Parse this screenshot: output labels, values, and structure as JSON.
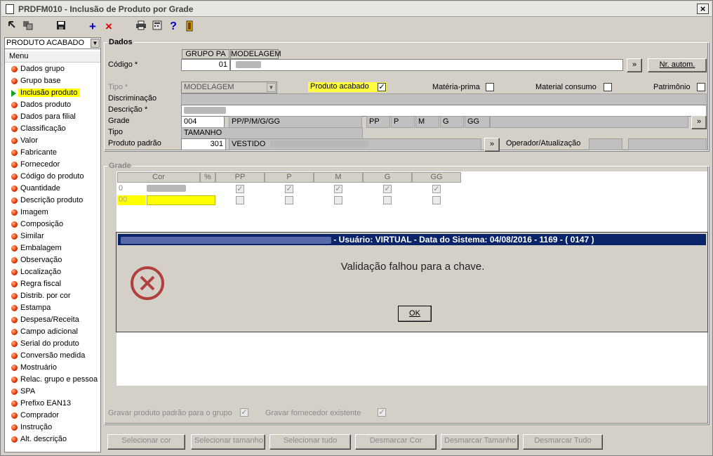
{
  "window": {
    "title": "PRDFM010 - Inclusão de Produto por Grade",
    "close": "×"
  },
  "toolbar": {
    "add": "+",
    "delete": "×",
    "help": "?"
  },
  "sidebar": {
    "combo": "PRODUTO ACABADO",
    "menu_header": "Menu",
    "items": [
      "Dados grupo",
      "Grupo base",
      "Inclusão produto",
      "Dados produto",
      "Dados para filial",
      "Classificação",
      "Valor",
      "Fabricante",
      "Fornecedor",
      "Código do produto",
      "Quantidade",
      "Descrição produto",
      "Imagem",
      "Composição",
      "Similar",
      "Embalagem",
      "Observação",
      "Localização",
      "Regra fiscal",
      "Distrib. por cor",
      "Estampa",
      "Despesa/Receita",
      "Campo adicional",
      "Serial do produto",
      "Conversão medida",
      "Mostruário",
      "Relac. grupo e pessoa",
      "SPA",
      "Prefixo EAN13",
      "Comprador",
      "Instrução",
      "Alt. descrição"
    ],
    "selected_index": 2
  },
  "dados": {
    "title": "Dados",
    "col_grupo": "GRUPO PA",
    "col_modelagem": "MODELAGEM",
    "codigo_label": "Código *",
    "codigo_value": "01",
    "nr_autom": "Nr. autom.",
    "more": "»",
    "tipo_label": "Tipo *",
    "tipo_value": "MODELAGEM",
    "produto_acabado": "Produto acabado",
    "materia_prima": "Matéria-prima",
    "material_consumo": "Material consumo",
    "patrimonio": "Patrimônio",
    "check_mark": "✓",
    "discriminacao": "Discriminação",
    "descricao": "Descrição *",
    "grade_label": "Grade",
    "grade_code": "004",
    "grade_desc": "PP/P/M/G/GG",
    "sizes": [
      "PP",
      "P",
      "M",
      "G",
      "GG"
    ],
    "tipo2_label": "Tipo",
    "tipo2_value": "TAMANHO",
    "produto_padrao_label": "Produto padrão",
    "produto_padrao_code": "301",
    "produto_padrao_desc": "VESTIDO",
    "operador_label": "Operador/Atualização"
  },
  "grade": {
    "title": "Grade",
    "col_cor": "Cor",
    "col_pct": "%",
    "rows": [
      {
        "code": "0"
      },
      {
        "code": "00"
      }
    ]
  },
  "dialog": {
    "title": "- Usuário: VIRTUAL - Data do Sistema: 04/08/2016 - 1169 - ( 0147 )",
    "message": "Validação falhou para a chave.",
    "ok": "OK"
  },
  "bottom": {
    "gravar_produto": "Gravar produto padrão para o grupo",
    "gravar_fornecedor": "Gravar fornecedor existente",
    "buttons": [
      "Selecionar cor",
      "Selecionar tamanho",
      "Selecionar tudo",
      "Desmarcar Cor",
      "Desmarcar Tamanho",
      "Desmarcar Tudo"
    ]
  }
}
